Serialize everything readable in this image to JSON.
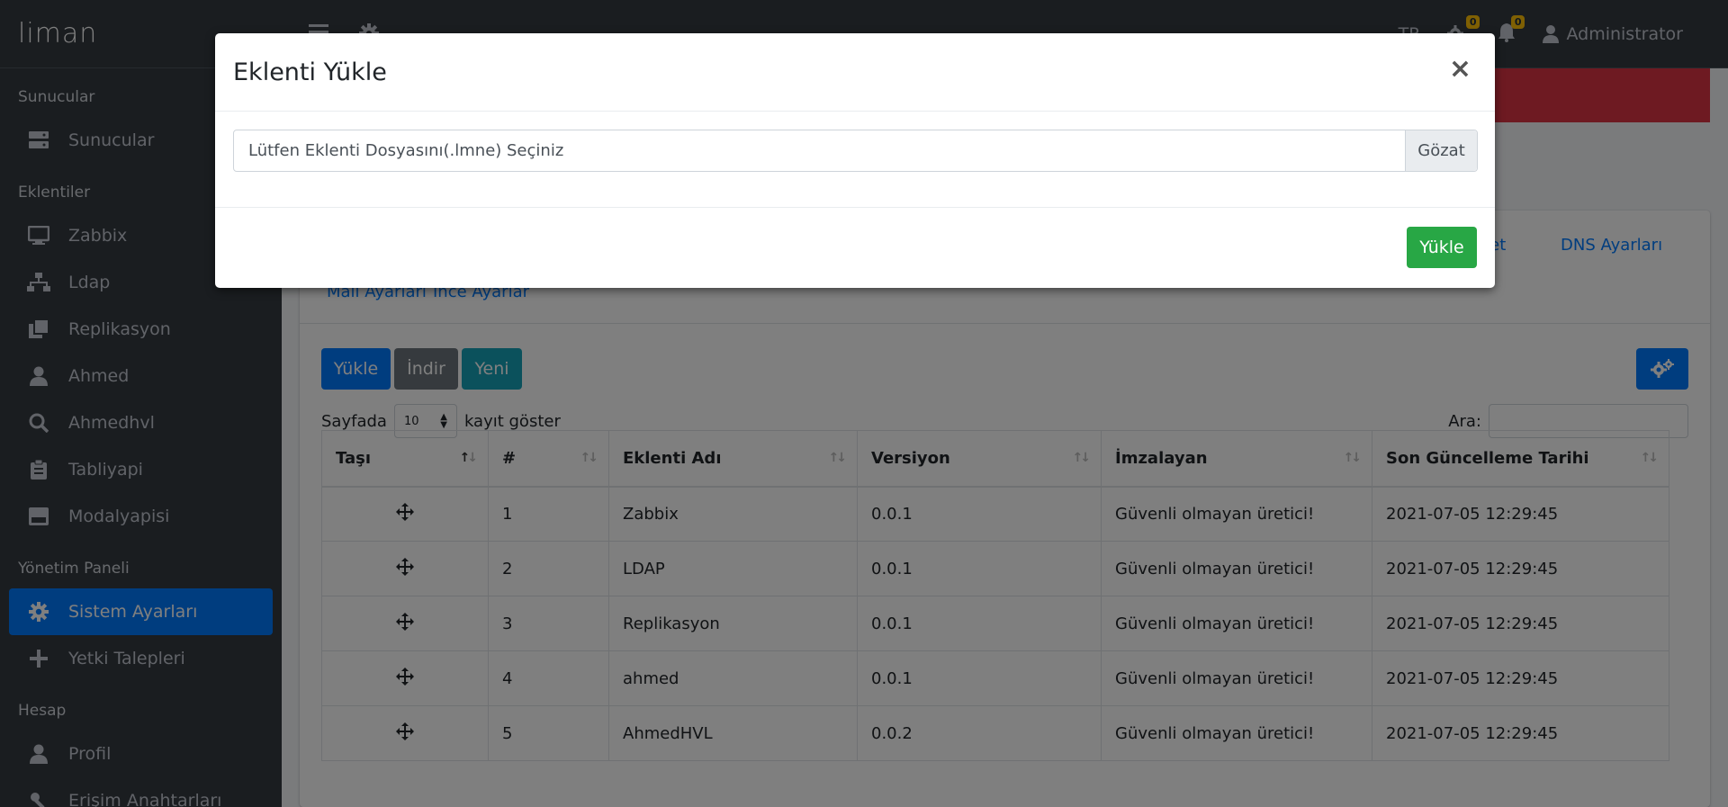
{
  "brand": "liman",
  "sidebar": {
    "sections": [
      {
        "header": "Sunucular",
        "items": [
          {
            "label": "Sunucular",
            "icon": "server-icon"
          }
        ]
      },
      {
        "header": "Eklentiler",
        "items": [
          {
            "label": "Zabbix",
            "icon": "desktop-icon"
          },
          {
            "label": "Ldap",
            "icon": "network-icon"
          },
          {
            "label": "Replikasyon",
            "icon": "copy-icon"
          },
          {
            "label": "Ahmed",
            "icon": "user-icon"
          },
          {
            "label": "Ahmedhvl",
            "icon": "search-icon"
          },
          {
            "label": "Tabliyapi",
            "icon": "clipboard-icon"
          },
          {
            "label": "Modalyapisi",
            "icon": "window-icon"
          }
        ]
      },
      {
        "header": "Yönetim Paneli",
        "items": [
          {
            "label": "Sistem Ayarları",
            "icon": "gear-icon",
            "active": true
          },
          {
            "label": "Yetki Talepleri",
            "icon": "plus-icon"
          }
        ]
      },
      {
        "header": "Hesap",
        "items": [
          {
            "label": "Profil",
            "icon": "user-icon"
          },
          {
            "label": "Erişim Anahtarları",
            "icon": "key-icon"
          }
        ]
      }
    ]
  },
  "navbar": {
    "language": "TR",
    "settings_badge": "0",
    "notifications_badge": "0",
    "user": "Administrator"
  },
  "tabs": {
    "market_partial": "rket",
    "dns": "DNS Ayarları",
    "mail": "Mail Ayarları",
    "fine": "İnce Ayarlar"
  },
  "toolbar": {
    "upload": "Yükle",
    "download": "İndir",
    "new": "Yeni"
  },
  "table_controls": {
    "show_prefix": "Sayfada",
    "page_size": "10",
    "show_suffix": "kayıt göster",
    "search_label": "Ara:"
  },
  "table": {
    "headers": [
      "Taşı",
      "#",
      "Eklenti Adı",
      "Versiyon",
      "İmzalayan",
      "Son Güncelleme Tarihi"
    ],
    "rows": [
      {
        "num": "1",
        "name": "Zabbix",
        "version": "0.0.1",
        "signer": "Güvenli olmayan üretici!",
        "updated": "2021-07-05 12:29:45"
      },
      {
        "num": "2",
        "name": "LDAP",
        "version": "0.0.1",
        "signer": "Güvenli olmayan üretici!",
        "updated": "2021-07-05 12:29:45"
      },
      {
        "num": "3",
        "name": "Replikasyon",
        "version": "0.0.1",
        "signer": "Güvenli olmayan üretici!",
        "updated": "2021-07-05 12:29:45"
      },
      {
        "num": "4",
        "name": "ahmed",
        "version": "0.0.1",
        "signer": "Güvenli olmayan üretici!",
        "updated": "2021-07-05 12:29:45"
      },
      {
        "num": "5",
        "name": "AhmedHVL",
        "version": "0.0.2",
        "signer": "Güvenli olmayan üretici!",
        "updated": "2021-07-05 12:29:45"
      }
    ]
  },
  "modal": {
    "title": "Eklenti Yükle",
    "close": "×",
    "file_placeholder": "Lütfen Eklenti Dosyasını(.lmne) Seçiniz",
    "browse": "Gözat",
    "submit": "Yükle"
  }
}
